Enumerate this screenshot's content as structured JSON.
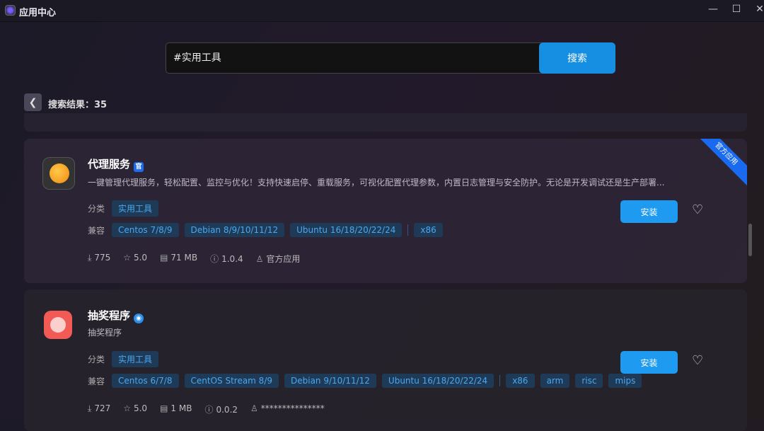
{
  "window": {
    "title": "应用中心",
    "minimize": "—",
    "maximize": "☐",
    "close": "✕"
  },
  "search": {
    "value": "#实用工具",
    "button": "搜索"
  },
  "results": {
    "label": "搜索结果：35"
  },
  "apps": [
    {
      "name": "代理服务",
      "badge": "官",
      "description": "一键管理代理服务，轻松配置、监控与优化！支持快速启停、重载服务，可视化配置代理参数，内置日志管理与安全防护。无论是开发调试还是生产部署...",
      "category_label": "分类",
      "category": "实用工具",
      "compat_label": "兼容",
      "os": [
        "Centos 7/8/9",
        "Debian 8/9/10/11/12",
        "Ubuntu 16/18/20/22/24"
      ],
      "arch": [
        "x86"
      ],
      "downloads": "775",
      "rating": "5.0",
      "size": "71 MB",
      "version": "1.0.4",
      "author": "官方应用",
      "ribbon": "官方应用",
      "install": "安装"
    },
    {
      "name": "抽奖程序",
      "badge": "◉",
      "description": "抽奖程序",
      "category_label": "分类",
      "category": "实用工具",
      "compat_label": "兼容",
      "os": [
        "Centos 6/7/8",
        "CentOS Stream 8/9",
        "Debian 9/10/11/12",
        "Ubuntu 16/18/20/22/24"
      ],
      "arch": [
        "x86",
        "arm",
        "risc",
        "mips"
      ],
      "downloads": "727",
      "rating": "5.0",
      "size": "1 MB",
      "version": "0.0.2",
      "author": "***************",
      "install": "安装"
    }
  ]
}
